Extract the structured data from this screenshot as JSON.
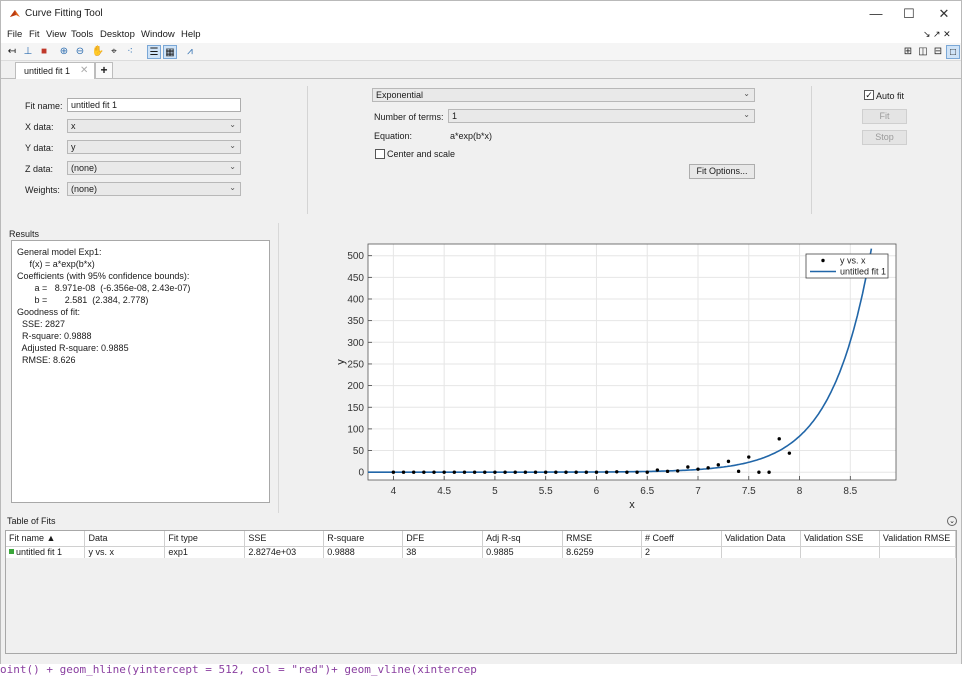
{
  "window": {
    "title": "Curve Fitting Tool",
    "minimize": "—",
    "maximize": "☐",
    "close": "✕"
  },
  "menu": [
    "File",
    "Fit",
    "View",
    "Tools",
    "Desktop",
    "Window",
    "Help"
  ],
  "menu_right": "↘ ↗ ✕",
  "tab": {
    "label": "untitled fit 1",
    "close": "✕",
    "add": "+"
  },
  "fit": {
    "name_label": "Fit name:",
    "name_value": "untitled fit 1",
    "x_label": "X data:",
    "x_value": "x",
    "y_label": "Y data:",
    "y_value": "y",
    "z_label": "Z data:",
    "z_value": "(none)",
    "w_label": "Weights:",
    "w_value": "(none)",
    "type_value": "Exponential",
    "terms_label": "Number of terms:",
    "terms_value": "1",
    "eq_label": "Equation:",
    "eq_value": "a*exp(b*x)",
    "center_label": "Center and scale",
    "options_button": "Fit Options...",
    "autofit_label": "Auto fit",
    "fit_button": "Fit",
    "stop_button": "Stop"
  },
  "results": {
    "header": "Results",
    "lines": [
      "General model Exp1:",
      "     f(x) = a*exp(b*x)",
      "Coefficients (with 95% confidence bounds):",
      "       a =   8.971e-08  (-6.356e-08, 2.43e-07)",
      "       b =       2.581  (2.384, 2.778)",
      "",
      "Goodness of fit:",
      "  SSE: 2827",
      "  R-square: 0.9888",
      "  Adjusted R-square: 0.9885",
      "  RMSE: 8.626"
    ]
  },
  "chart_data": {
    "type": "scatter",
    "xlabel": "x",
    "ylabel": "y",
    "xlim": [
      3.75,
      8.95
    ],
    "ylim": [
      -18,
      527
    ],
    "xticks": [
      4,
      4.5,
      5,
      5.5,
      6,
      6.5,
      7,
      7.5,
      8,
      8.5
    ],
    "yticks": [
      0,
      50,
      100,
      150,
      200,
      250,
      300,
      350,
      400,
      450,
      500
    ],
    "grid": true,
    "legend_position": "top-right",
    "legend": [
      "y vs. x",
      "untitled fit 1"
    ],
    "series": [
      {
        "name": "y vs. x",
        "kind": "points",
        "x": [
          4.0,
          4.1,
          4.2,
          4.3,
          4.4,
          4.5,
          4.6,
          4.7,
          4.8,
          4.9,
          5.0,
          5.1,
          5.2,
          5.3,
          5.4,
          5.5,
          5.6,
          5.7,
          5.8,
          5.9,
          6.0,
          6.1,
          6.2,
          6.3,
          6.4,
          6.5,
          6.6,
          6.7,
          6.8,
          6.9,
          7.0,
          7.1,
          7.2,
          7.3,
          7.4,
          7.5,
          7.6,
          7.7,
          7.8,
          7.9
        ],
        "y": [
          0,
          0,
          0,
          0,
          0,
          0,
          0,
          0,
          0,
          0,
          0,
          0,
          0,
          0,
          0,
          0,
          0,
          0,
          0,
          0,
          0,
          0,
          1,
          0,
          0,
          0,
          5,
          2,
          3,
          12,
          7,
          10,
          17,
          25,
          2,
          35,
          0,
          0,
          77,
          44
        ]
      },
      {
        "name": "untitled fit 1",
        "kind": "curve",
        "a": 8.971e-08,
        "b": 2.581
      }
    ],
    "colors": {
      "points": "#000000",
      "curve": "#2166a8"
    }
  },
  "table": {
    "header": "Table of Fits",
    "collapse": "⌄",
    "columns": [
      "Fit name ▲",
      "Data",
      "Fit type",
      "SSE",
      "R-square",
      "DFE",
      "Adj R-sq",
      "RMSE",
      "# Coeff",
      "Validation Data",
      "Validation SSE",
      "Validation RMSE"
    ],
    "rows": [
      [
        "untitled fit 1",
        "y vs. x",
        "exp1",
        "2.8274e+03",
        "0.9888",
        "38",
        "0.9885",
        "8.6259",
        "2",
        "",
        "",
        ""
      ]
    ]
  },
  "background_code": "oint() + geom_hline(yintercept = 512, col = \"red\")+ geom_vline(xintercep"
}
